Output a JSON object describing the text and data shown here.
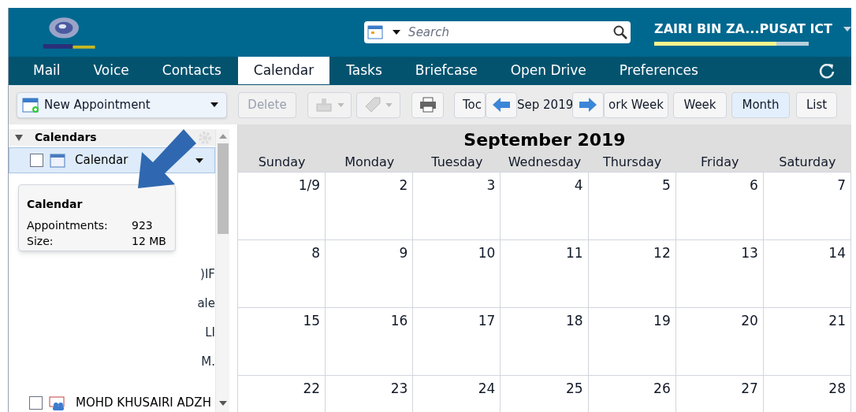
{
  "header": {
    "search": {
      "placeholder": "Search"
    },
    "user": "ZAIRI BIN ZA...PUSAT ICT",
    "quota": {
      "level": 0.79
    }
  },
  "tabs": [
    {
      "label": "Mail",
      "selected": false
    },
    {
      "label": "Voice",
      "selected": false
    },
    {
      "label": "Contacts",
      "selected": false
    },
    {
      "label": "Calendar",
      "selected": true
    },
    {
      "label": "Tasks",
      "selected": false
    },
    {
      "label": "Briefcase",
      "selected": false
    },
    {
      "label": "Open Drive",
      "selected": false
    },
    {
      "label": "Preferences",
      "selected": false
    }
  ],
  "toolbar": {
    "new_appointment": "New Appointment",
    "delete": {
      "label": "Delete",
      "disabled": true
    },
    "date_label": "Sep 2019",
    "views": [
      {
        "label": "Toc",
        "selected": false
      },
      {
        "label": "ork Week",
        "selected": false
      },
      {
        "label": "Week",
        "selected": false
      },
      {
        "label": "Month",
        "selected": true
      },
      {
        "label": "List",
        "selected": false
      }
    ]
  },
  "sidebar": {
    "heading": "Calendars",
    "expanded": true,
    "items": [
      {
        "label": "Calendar",
        "kind": "calendar",
        "checked": false,
        "selected": true
      },
      {
        "label": ")IF",
        "kind": "fragment"
      },
      {
        "label": "ale",
        "kind": "fragment"
      },
      {
        "label": "LI",
        "kind": "fragment"
      },
      {
        "label": "M.",
        "kind": "fragment"
      },
      {
        "label": "MOHD KHUSAIRI ADZH",
        "kind": "shared",
        "checked": false,
        "selected": false
      }
    ]
  },
  "tooltip": {
    "title": "Calendar",
    "rows": [
      {
        "label": "Appointments:",
        "value": "923"
      },
      {
        "label": "Size:",
        "value": "12 MB"
      }
    ]
  },
  "calendar": {
    "title": "September 2019",
    "weekdays": [
      "Sunday",
      "Monday",
      "Tuesday",
      "Wednesday",
      "Thursday",
      "Friday",
      "Saturday"
    ],
    "weeks": [
      [
        "1/9",
        "2",
        "3",
        "4",
        "5",
        "6",
        "7"
      ],
      [
        "8",
        "9",
        "10",
        "11",
        "12",
        "13",
        "14"
      ],
      [
        "15",
        "16",
        "17",
        "18",
        "19",
        "20",
        "21"
      ],
      [
        "22",
        "23",
        "24",
        "25",
        "26",
        "27",
        "28"
      ]
    ]
  }
}
